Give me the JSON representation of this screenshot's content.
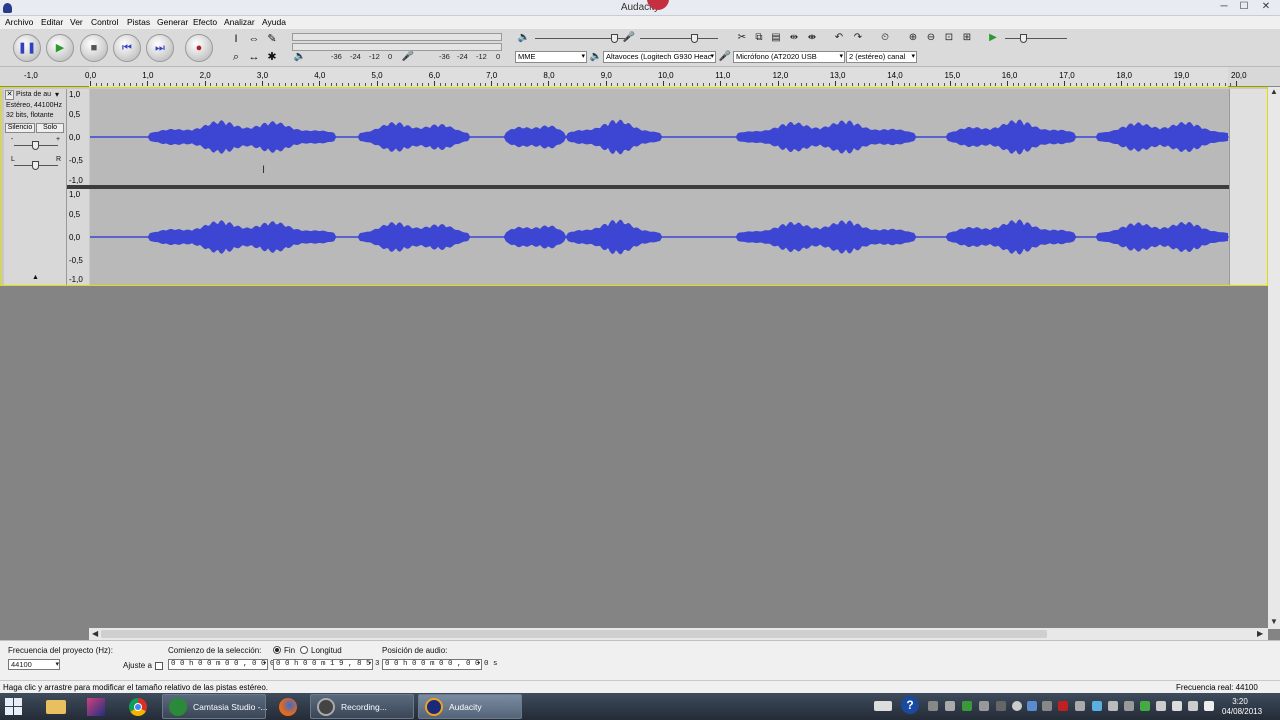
{
  "window": {
    "title": "Audacity",
    "minimize": "─",
    "maximize": "☐",
    "close": "✕"
  },
  "menu": [
    "Archivo",
    "Editar",
    "Ver",
    "Control",
    "Pistas",
    "Generar",
    "Efecto",
    "Analizar",
    "Ayuda"
  ],
  "meters": {
    "play_label": "L R",
    "scale": [
      "-36",
      "-24",
      "-12",
      "0"
    ],
    "rec_scale": [
      "-36",
      "-24",
      "-12",
      "0"
    ]
  },
  "devices": {
    "host": "MME",
    "output": "Altavoces (Logitech G930 Heac",
    "input": "Micrófono (AT2020 USB",
    "channels": "2 (estéreo) canal"
  },
  "ruler": {
    "labels": [
      "-1,0",
      "0,0",
      "1,0",
      "2,0",
      "3,0",
      "4,0",
      "5,0",
      "6,0",
      "7,0",
      "8,0",
      "9,0",
      "10,0",
      "11,0",
      "12,0",
      "13,0",
      "14,0",
      "15,0",
      "16,0",
      "17,0",
      "18,0",
      "19,0",
      "20,0"
    ]
  },
  "track": {
    "name": "Pista de au",
    "close": "✕",
    "format_line1": "Estéreo, 44100Hz",
    "format_line2": "32 bits, flotante",
    "mute_label": "Silencio",
    "solo_label": "Solo",
    "gain_minus": "-",
    "gain_plus": "+",
    "pan_left": "L",
    "pan_right": "R",
    "collapse": "▲"
  },
  "amplitude_labels": [
    "1,0",
    "0,5",
    "0,0",
    "-0,5",
    "-1,0"
  ],
  "colors": {
    "waveform": "#3c46d2",
    "waveform_bg": "#b9b9b9",
    "center_line": "#3c46d2"
  },
  "selection": {
    "project_rate_label": "Frecuencia del proyecto (Hz):",
    "project_rate": "44100",
    "snap_label": "Ajuste a",
    "start_label": "Comienzo de la selección:",
    "end_option": "Fin",
    "length_option": "Longitud",
    "start_value": "0 0 h 0 0 m 0 0 , 0 0 0 s",
    "end_value": "0 0 h 0 0 m 1 9 , 8 5 3 s",
    "audio_pos_label": "Posición de audio:",
    "audio_pos_value": "0 0 h 0 0 m 0 0 , 0 0 0 s"
  },
  "status": {
    "message": "Haga clic y arrastre para modificar el tamaño relativo de las pistas estéreo.",
    "rate": "Frecuencia real: 44100"
  },
  "taskbar": {
    "items": [
      {
        "label": "Camtasia Studio -...",
        "icon": "camtasia-icon"
      },
      {
        "label": "Recording...",
        "icon": "recorder-icon"
      },
      {
        "label": "Audacity",
        "icon": "audacity-icon"
      }
    ],
    "time": "3:20",
    "date": "04/08/2013"
  }
}
